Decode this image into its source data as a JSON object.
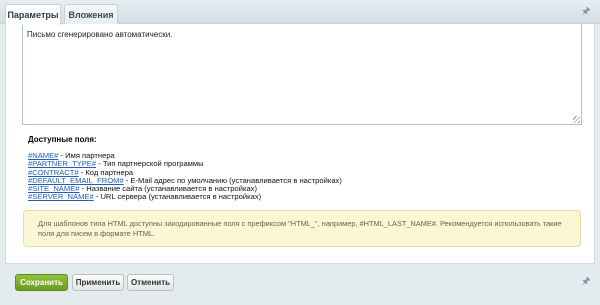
{
  "tabs": [
    {
      "label": "Параметры",
      "active": true
    },
    {
      "label": "Вложения",
      "active": false
    }
  ],
  "editor": {
    "text": "Письмо сгенерировано автоматически."
  },
  "fields": {
    "title": "Доступные поля:",
    "items": [
      {
        "code": "#NAME#",
        "desc": " - Имя партнера"
      },
      {
        "code": "#PARTNER_TYPE#",
        "desc": " - Тип партнерской программы"
      },
      {
        "code": "#CONTRACT#",
        "desc": " - Код партнера"
      },
      {
        "code": "#DEFAULT_EMAIL_FROM#",
        "desc": " - E-Mail адрес по умолчанию (устанавливается в настройках)"
      },
      {
        "code": "#SITE_NAME#",
        "desc": " - Название сайта (устанавливается в настройках)"
      },
      {
        "code": "#SERVER_NAME#",
        "desc": " - URL сервера (устанавливается в настройках)"
      }
    ]
  },
  "note": {
    "text": "Для шаблонов типа HTML доступны закодированные поля с префиксом \"HTML_\", например, #HTML_LAST_NAME#. Рекомендуется использовать такие поля для писем в формате HTML."
  },
  "buttons": {
    "save": "Сохранить",
    "apply": "Применить",
    "cancel": "Отменить"
  },
  "icons": {
    "pin_top": "pin-icon",
    "pin_bottom": "pin-icon"
  },
  "colors": {
    "save_button": "#7aae2e",
    "link": "#1f5fb5",
    "note_bg": "#fbf6d4"
  }
}
